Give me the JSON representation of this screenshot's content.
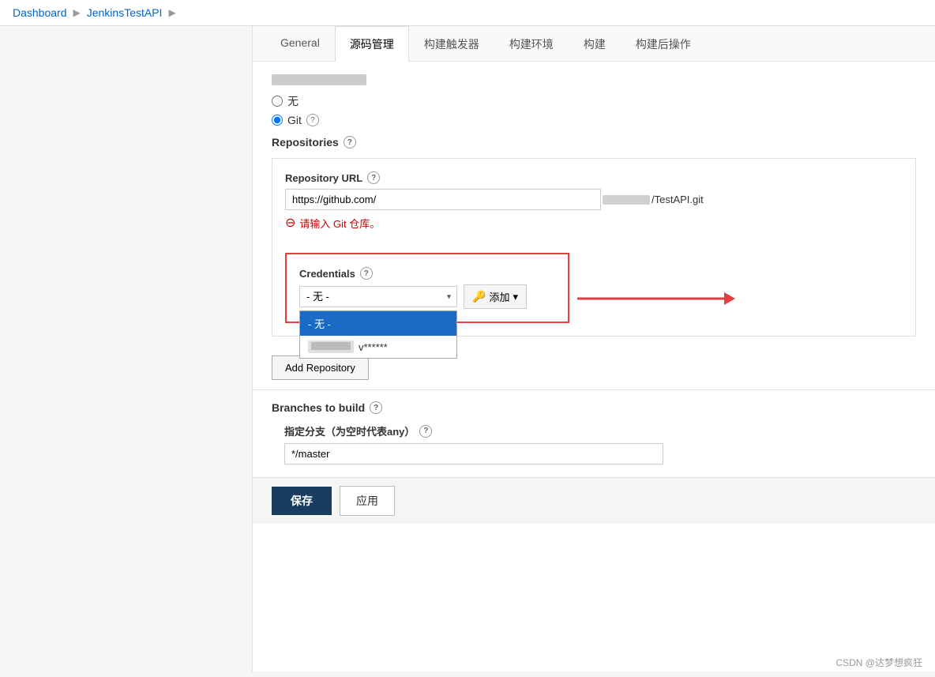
{
  "breadcrumb": {
    "items": [
      "Dashboard",
      "JenkinsTestAPI"
    ]
  },
  "tabs": [
    {
      "label": "General",
      "active": false
    },
    {
      "label": "源码管理",
      "active": true
    },
    {
      "label": "构建触发器",
      "active": false
    },
    {
      "label": "构建环境",
      "active": false
    },
    {
      "label": "构建",
      "active": false
    },
    {
      "label": "构建后操作",
      "active": false
    }
  ],
  "scm": {
    "radio_none_label": "无",
    "radio_git_label": "Git",
    "repositories_label": "Repositories",
    "repository_url_label": "Repository URL",
    "repository_url_value": "https://github.com/",
    "repository_url_suffix": "/TestAPI.git",
    "error_message": "请输入 Git 仓库。",
    "credentials_label": "Credentials",
    "credentials_none_option": "- 无 -",
    "credentials_add_label": "🔑 添加 ▾",
    "dropdown_items": [
      {
        "label": "- 无 -",
        "selected": true
      },
      {
        "label": "v******",
        "has_username": true,
        "username_placeholder": ""
      }
    ],
    "add_repository_label": "Add Repository",
    "branches_label": "Branches to build",
    "branch_specifier_label": "指定分支（为空时代表any）",
    "branch_specifier_value": "*/master"
  },
  "footer": {
    "save_label": "保存",
    "apply_label": "应用"
  },
  "watermark": "CSDN @达梦想疯狂"
}
